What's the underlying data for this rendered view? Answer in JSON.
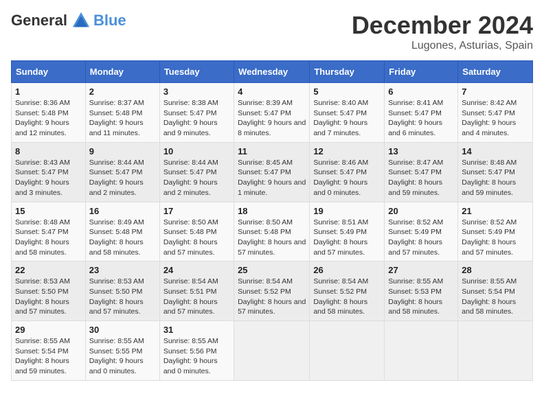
{
  "header": {
    "logo_general": "General",
    "logo_blue": "Blue",
    "month_year": "December 2024",
    "location": "Lugones, Asturias, Spain"
  },
  "days_of_week": [
    "Sunday",
    "Monday",
    "Tuesday",
    "Wednesday",
    "Thursday",
    "Friday",
    "Saturday"
  ],
  "weeks": [
    [
      {
        "day": "1",
        "sunrise": "Sunrise: 8:36 AM",
        "sunset": "Sunset: 5:48 PM",
        "daylight": "Daylight: 9 hours and 12 minutes."
      },
      {
        "day": "2",
        "sunrise": "Sunrise: 8:37 AM",
        "sunset": "Sunset: 5:48 PM",
        "daylight": "Daylight: 9 hours and 11 minutes."
      },
      {
        "day": "3",
        "sunrise": "Sunrise: 8:38 AM",
        "sunset": "Sunset: 5:47 PM",
        "daylight": "Daylight: 9 hours and 9 minutes."
      },
      {
        "day": "4",
        "sunrise": "Sunrise: 8:39 AM",
        "sunset": "Sunset: 5:47 PM",
        "daylight": "Daylight: 9 hours and 8 minutes."
      },
      {
        "day": "5",
        "sunrise": "Sunrise: 8:40 AM",
        "sunset": "Sunset: 5:47 PM",
        "daylight": "Daylight: 9 hours and 7 minutes."
      },
      {
        "day": "6",
        "sunrise": "Sunrise: 8:41 AM",
        "sunset": "Sunset: 5:47 PM",
        "daylight": "Daylight: 9 hours and 6 minutes."
      },
      {
        "day": "7",
        "sunrise": "Sunrise: 8:42 AM",
        "sunset": "Sunset: 5:47 PM",
        "daylight": "Daylight: 9 hours and 4 minutes."
      }
    ],
    [
      {
        "day": "8",
        "sunrise": "Sunrise: 8:43 AM",
        "sunset": "Sunset: 5:47 PM",
        "daylight": "Daylight: 9 hours and 3 minutes."
      },
      {
        "day": "9",
        "sunrise": "Sunrise: 8:44 AM",
        "sunset": "Sunset: 5:47 PM",
        "daylight": "Daylight: 9 hours and 2 minutes."
      },
      {
        "day": "10",
        "sunrise": "Sunrise: 8:44 AM",
        "sunset": "Sunset: 5:47 PM",
        "daylight": "Daylight: 9 hours and 2 minutes."
      },
      {
        "day": "11",
        "sunrise": "Sunrise: 8:45 AM",
        "sunset": "Sunset: 5:47 PM",
        "daylight": "Daylight: 9 hours and 1 minute."
      },
      {
        "day": "12",
        "sunrise": "Sunrise: 8:46 AM",
        "sunset": "Sunset: 5:47 PM",
        "daylight": "Daylight: 9 hours and 0 minutes."
      },
      {
        "day": "13",
        "sunrise": "Sunrise: 8:47 AM",
        "sunset": "Sunset: 5:47 PM",
        "daylight": "Daylight: 8 hours and 59 minutes."
      },
      {
        "day": "14",
        "sunrise": "Sunrise: 8:48 AM",
        "sunset": "Sunset: 5:47 PM",
        "daylight": "Daylight: 8 hours and 59 minutes."
      }
    ],
    [
      {
        "day": "15",
        "sunrise": "Sunrise: 8:48 AM",
        "sunset": "Sunset: 5:47 PM",
        "daylight": "Daylight: 8 hours and 58 minutes."
      },
      {
        "day": "16",
        "sunrise": "Sunrise: 8:49 AM",
        "sunset": "Sunset: 5:48 PM",
        "daylight": "Daylight: 8 hours and 58 minutes."
      },
      {
        "day": "17",
        "sunrise": "Sunrise: 8:50 AM",
        "sunset": "Sunset: 5:48 PM",
        "daylight": "Daylight: 8 hours and 57 minutes."
      },
      {
        "day": "18",
        "sunrise": "Sunrise: 8:50 AM",
        "sunset": "Sunset: 5:48 PM",
        "daylight": "Daylight: 8 hours and 57 minutes."
      },
      {
        "day": "19",
        "sunrise": "Sunrise: 8:51 AM",
        "sunset": "Sunset: 5:49 PM",
        "daylight": "Daylight: 8 hours and 57 minutes."
      },
      {
        "day": "20",
        "sunrise": "Sunrise: 8:52 AM",
        "sunset": "Sunset: 5:49 PM",
        "daylight": "Daylight: 8 hours and 57 minutes."
      },
      {
        "day": "21",
        "sunrise": "Sunrise: 8:52 AM",
        "sunset": "Sunset: 5:49 PM",
        "daylight": "Daylight: 8 hours and 57 minutes."
      }
    ],
    [
      {
        "day": "22",
        "sunrise": "Sunrise: 8:53 AM",
        "sunset": "Sunset: 5:50 PM",
        "daylight": "Daylight: 8 hours and 57 minutes."
      },
      {
        "day": "23",
        "sunrise": "Sunrise: 8:53 AM",
        "sunset": "Sunset: 5:50 PM",
        "daylight": "Daylight: 8 hours and 57 minutes."
      },
      {
        "day": "24",
        "sunrise": "Sunrise: 8:54 AM",
        "sunset": "Sunset: 5:51 PM",
        "daylight": "Daylight: 8 hours and 57 minutes."
      },
      {
        "day": "25",
        "sunrise": "Sunrise: 8:54 AM",
        "sunset": "Sunset: 5:52 PM",
        "daylight": "Daylight: 8 hours and 57 minutes."
      },
      {
        "day": "26",
        "sunrise": "Sunrise: 8:54 AM",
        "sunset": "Sunset: 5:52 PM",
        "daylight": "Daylight: 8 hours and 58 minutes."
      },
      {
        "day": "27",
        "sunrise": "Sunrise: 8:55 AM",
        "sunset": "Sunset: 5:53 PM",
        "daylight": "Daylight: 8 hours and 58 minutes."
      },
      {
        "day": "28",
        "sunrise": "Sunrise: 8:55 AM",
        "sunset": "Sunset: 5:54 PM",
        "daylight": "Daylight: 8 hours and 58 minutes."
      }
    ],
    [
      {
        "day": "29",
        "sunrise": "Sunrise: 8:55 AM",
        "sunset": "Sunset: 5:54 PM",
        "daylight": "Daylight: 8 hours and 59 minutes."
      },
      {
        "day": "30",
        "sunrise": "Sunrise: 8:55 AM",
        "sunset": "Sunset: 5:55 PM",
        "daylight": "Daylight: 9 hours and 0 minutes."
      },
      {
        "day": "31",
        "sunrise": "Sunrise: 8:55 AM",
        "sunset": "Sunset: 5:56 PM",
        "daylight": "Daylight: 9 hours and 0 minutes."
      },
      null,
      null,
      null,
      null
    ]
  ]
}
